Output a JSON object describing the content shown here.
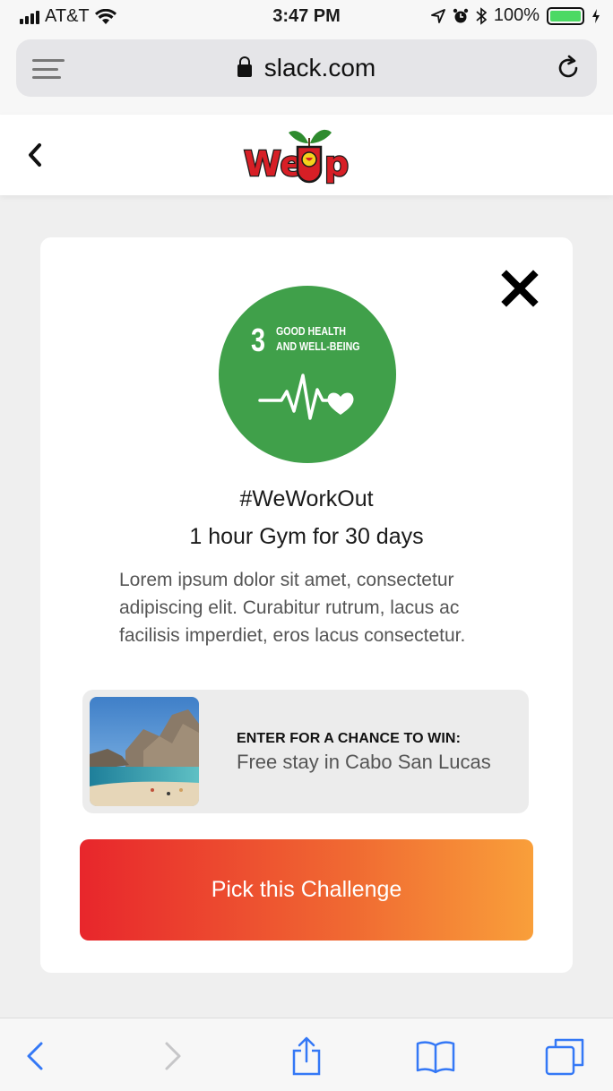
{
  "status_bar": {
    "carrier": "AT&T",
    "time": "3:47 PM",
    "battery": "100%",
    "battery_level": 1.0
  },
  "browser": {
    "url": "slack.com",
    "icons": [
      "reader-menu-icon",
      "lock-icon",
      "reload-icon"
    ]
  },
  "header": {
    "logo_text": "WeUp",
    "back_icon": "chevron-left-icon"
  },
  "challenge": {
    "goal_number": "3",
    "goal_label_line1": "GOOD HEALTH",
    "goal_label_line2": "AND WELL-BEING",
    "goal_color": "#40a04a",
    "hashtag": "#WeWorkOut",
    "subtitle": "1 hour Gym for 30 days",
    "description": "Lorem ipsum dolor sit amet, consectetur adipiscing elit. Curabitur rutrum, lacus ac facilisis imperdiet, eros lacus consectetur.",
    "prize_heading": "ENTER FOR A CHANCE TO WIN:",
    "prize_text": "Free stay in Cabo San Lucas",
    "cta_label": "Pick this Challenge",
    "cta_gradient": [
      "#e8262c",
      "#f06a32",
      "#f99f3a"
    ]
  },
  "toolbar": {
    "icons": [
      "back-arrow-icon",
      "forward-arrow-icon",
      "share-icon",
      "bookmarks-icon",
      "tabs-icon"
    ],
    "accent": "#3478f6"
  }
}
